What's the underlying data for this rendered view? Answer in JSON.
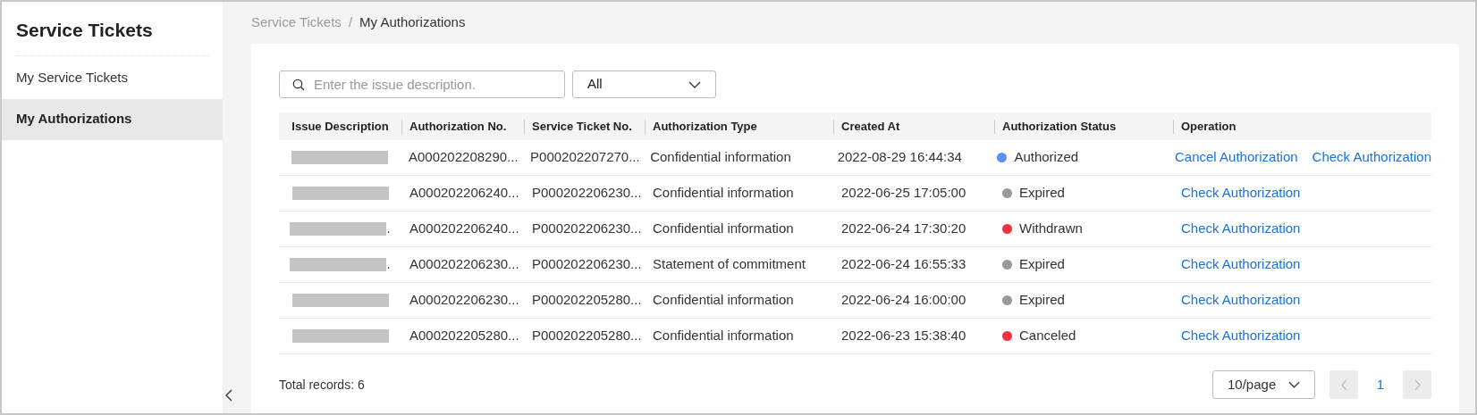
{
  "sidebar": {
    "title": "Service Tickets",
    "items": [
      {
        "label": "My Service Tickets",
        "selected": false
      },
      {
        "label": "My Authorizations",
        "selected": true
      }
    ]
  },
  "breadcrumb": [
    "Service Tickets",
    "My Authorizations"
  ],
  "breadcrumb_separator": "/",
  "search": {
    "placeholder": "Enter the issue description."
  },
  "filter": {
    "value": "All"
  },
  "table": {
    "columns": [
      "Issue Description",
      "Authorization No.",
      "Service Ticket No.",
      "Authorization Type",
      "Created At",
      "Authorization Status",
      "Operation"
    ],
    "rows": [
      {
        "issue_tail": "",
        "authorization_no": "A000202208290...",
        "service_ticket_no": "P000202207270...",
        "type": "Confidential information",
        "created_at": "2022-08-29 16:44:34",
        "status": "Authorized",
        "color": "#5b8ff9",
        "operations": [
          "Cancel Authorization",
          "Check Authorization"
        ]
      },
      {
        "issue_tail": "",
        "authorization_no": "A000202206240...",
        "service_ticket_no": "P000202206230...",
        "type": "Confidential information",
        "created_at": "2022-06-25 17:05:00",
        "status": "Expired",
        "color": "#999999",
        "operations": [
          "Check Authorization"
        ]
      },
      {
        "issue_tail": ".",
        "authorization_no": "A000202206240...",
        "service_ticket_no": "P000202206230...",
        "type": "Confidential information",
        "created_at": "2022-06-24 17:30:20",
        "status": "Withdrawn",
        "color": "#f5313d",
        "operations": [
          "Check Authorization"
        ]
      },
      {
        "issue_tail": ".",
        "authorization_no": "A000202206230...",
        "service_ticket_no": "P000202206230...",
        "type": "Statement of commitment",
        "created_at": "2022-06-24 16:55:33",
        "status": "Expired",
        "color": "#999999",
        "operations": [
          "Check Authorization"
        ]
      },
      {
        "issue_tail": "",
        "authorization_no": "A000202206230...",
        "service_ticket_no": "P000202205280...",
        "type": "Confidential information",
        "created_at": "2022-06-24 16:00:00",
        "status": "Expired",
        "color": "#999999",
        "operations": [
          "Check Authorization"
        ]
      },
      {
        "issue_tail": "",
        "authorization_no": "A000202205280...",
        "service_ticket_no": "P000202205280...",
        "type": "Confidential information",
        "created_at": "2022-06-23 15:38:40",
        "status": "Canceled",
        "color": "#f5313d",
        "operations": [
          "Check Authorization"
        ]
      }
    ]
  },
  "total": "Total records: 6",
  "pagination": {
    "page_size": "10/page",
    "pages": [
      {
        "label": "1",
        "selected": true
      }
    ]
  }
}
